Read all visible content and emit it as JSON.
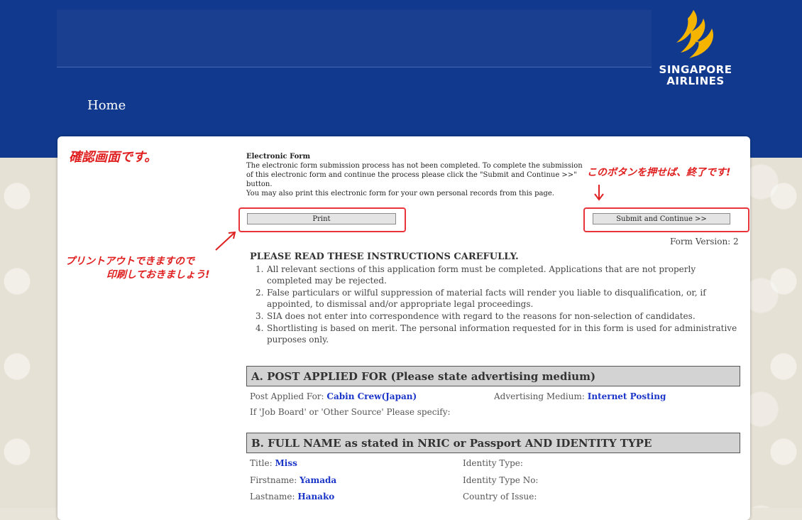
{
  "header": {
    "home_label": "Home",
    "logo_line1": "SINGAPORE",
    "logo_line2": "AIRLINES"
  },
  "annotations": {
    "confirm_screen": "確認画面です。",
    "print_note_line1": "プリントアウトできますので",
    "print_note_line2": "印刷しておきましょう!",
    "submit_note": "このボタンを押せば、終了です!"
  },
  "intro": {
    "title": "Electronic Form",
    "body": "The electronic form submission process has not been completed. To complete the submission of this electronic form and continue the process please click the \"Submit and Continue >>\" button.",
    "print_text": "You may also print this electronic form for your own personal records from this page."
  },
  "buttons": {
    "print": "Print",
    "submit": "Submit and Continue >>"
  },
  "form_version": "Form Version: 2",
  "instructions": {
    "title": "PLEASE READ THESE INSTRUCTIONS CAREFULLY.",
    "items": [
      {
        "num": "1.",
        "text": "All relevant sections of this application form must be completed. Applications that are not properly completed may be rejected."
      },
      {
        "num": "2.",
        "text": "False particulars or wilful suppression of material facts will render you liable to disqualification, or, if appointed, to dismissal and/or appropriate legal proceedings."
      },
      {
        "num": "3.",
        "text": "SIA does not enter into correspondence with regard to the reasons for non-selection of candidates."
      },
      {
        "num": "4.",
        "text": "Shortlisting is based on merit. The personal information requested for in this form is used for administrative purposes only."
      }
    ]
  },
  "section_a": {
    "title": "A. POST APPLIED FOR (Please state advertising medium)",
    "post_label": "Post Applied For:",
    "post_value": "Cabin Crew(Japan)",
    "medium_label": "Advertising Medium:",
    "medium_value": "Internet Posting",
    "specify_label": "If 'Job Board' or 'Other Source' Please specify:"
  },
  "section_b": {
    "title": "B. FULL NAME as stated in NRIC or Passport AND IDENTITY TYPE",
    "title_label": "Title:",
    "title_value": "Miss",
    "firstname_label": "Firstname:",
    "firstname_value": "Yamada",
    "lastname_label": "Lastname:",
    "lastname_value": "Hanako",
    "id_type_label": "Identity Type:",
    "id_no_label": "Identity Type No:",
    "country_label": "Country of Issue:"
  },
  "colors": {
    "header_blue": "#113a8f",
    "annotation_red": "#e02020",
    "value_blue": "#1a35c8",
    "logo_gold": "#f5b400"
  }
}
